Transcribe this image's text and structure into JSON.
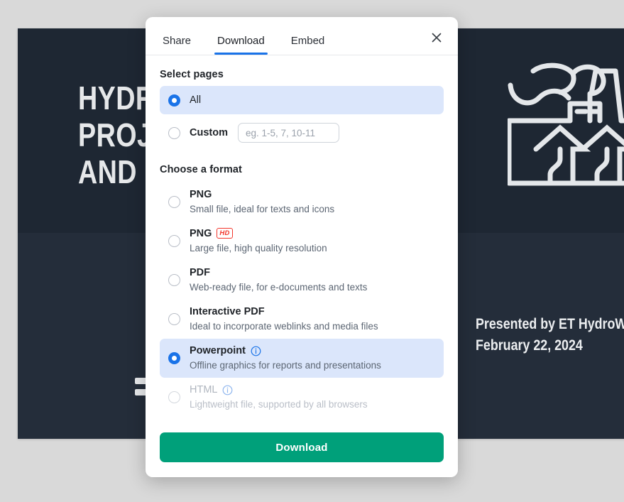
{
  "slide": {
    "title": "HYDROGEN\nPROJECT PLAN\nAND IMPACT",
    "presenter_line": "Presented by ET HydroWa",
    "date_line": "February 22, 2024",
    "illustration": "factory-icon",
    "bg_dark": "#1e2733",
    "bg_dark_lower": "#242d3a"
  },
  "modal": {
    "tabs": [
      {
        "label": "Share",
        "active": false
      },
      {
        "label": "Download",
        "active": true
      },
      {
        "label": "Embed",
        "active": false
      }
    ],
    "close_icon": "close-icon",
    "accent_color": "#1a73e8",
    "highlight_color": "#dbe6fb",
    "pages": {
      "title": "Select pages",
      "options": [
        {
          "label": "All",
          "selected": true
        },
        {
          "label": "Custom",
          "selected": false
        }
      ],
      "custom_input": {
        "value": "",
        "placeholder": "eg. 1-5, 7, 10-11"
      }
    },
    "format": {
      "title": "Choose a format",
      "options": [
        {
          "label": "PNG",
          "description": "Small file, ideal for texts and icons",
          "selected": false,
          "disabled": false,
          "badge": "",
          "info": false
        },
        {
          "label": "PNG",
          "description": "Large file, high quality resolution",
          "selected": false,
          "disabled": false,
          "badge": "HD",
          "info": false
        },
        {
          "label": "PDF",
          "description": "Web-ready file, for e-documents and texts",
          "selected": false,
          "disabled": false,
          "badge": "",
          "info": false
        },
        {
          "label": "Interactive PDF",
          "description": "Ideal to incorporate weblinks and media files",
          "selected": false,
          "disabled": false,
          "badge": "",
          "info": false
        },
        {
          "label": "Powerpoint",
          "description": "Offline graphics for reports and presentations",
          "selected": true,
          "disabled": false,
          "badge": "",
          "info": true
        },
        {
          "label": "HTML",
          "description": "Lightweight file, supported by all browsers",
          "selected": false,
          "disabled": true,
          "badge": "",
          "info": true
        }
      ]
    },
    "footer": {
      "download_label": "Download",
      "download_color": "#00a07a"
    }
  }
}
